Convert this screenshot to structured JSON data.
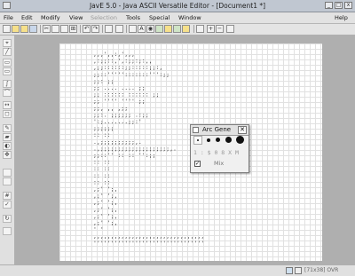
{
  "window": {
    "title": "JavE 5.0 - Java ASCII Versatile Editor - [Document1 *]"
  },
  "menu": [
    {
      "label": "File",
      "enabled": true
    },
    {
      "label": "Edit",
      "enabled": true
    },
    {
      "label": "Modify",
      "enabled": true
    },
    {
      "label": "View",
      "enabled": true
    },
    {
      "label": "Selection",
      "enabled": false
    },
    {
      "label": "Tools",
      "enabled": true
    },
    {
      "label": "Special",
      "enabled": true
    },
    {
      "label": "Window",
      "enabled": true
    }
  ],
  "help_menu": "Help",
  "dialog": {
    "title": "Arc Gene",
    "chars": "1 : $ 0 8 X M",
    "mix_label": "Mix",
    "mix_checked": true
  },
  "status": {
    "text": "[71x38] OVR"
  },
  "ascii_art": [
    "                  ,,,',,:,',,,",
    "              ,:;;::,',:;;:;:,,",
    "            ,;;::::::;;:::::;;:,",
    "           ;;::''''':::::::''':;;",
    "          ;;:                   ;;",
    "          ;;  ....    ....       ;;",
    "         ;;  ::::::  ::::::      ;;",
    "          ;;  ''''    ''''      ;;",
    "           ;;,      ,,        ,;;",
    "            ;;:.  ;;;;;;   .:;;",
    "              ':;.......;;:'",
    "                  ;;;;;;",
    "                  ::  ::",
    "              .,;;;;;;;;;;,.",
    "         .,;;;;;;;;;;;;;;;;;;;;,.",
    "       ;;::''    ::  ::     '':;;",
    "                  ::  ::",
    "                  ::  ::",
    "                  ::  ::",
    "                  ::  ::",
    "                ,;'    ';,",
    "              ,;'        ';,",
    "            ,;'            ';,",
    "          ,;'                ';,",
    "        ,;'                    ';,",
    "      ,;'                        ';,",
    "      '                            '",
    "     ,,,,,,,,,,,,,,,,,,,,,,,,,,,,,,,,",
    "     ''''''''''''''''''''''''''''''''"
  ]
}
